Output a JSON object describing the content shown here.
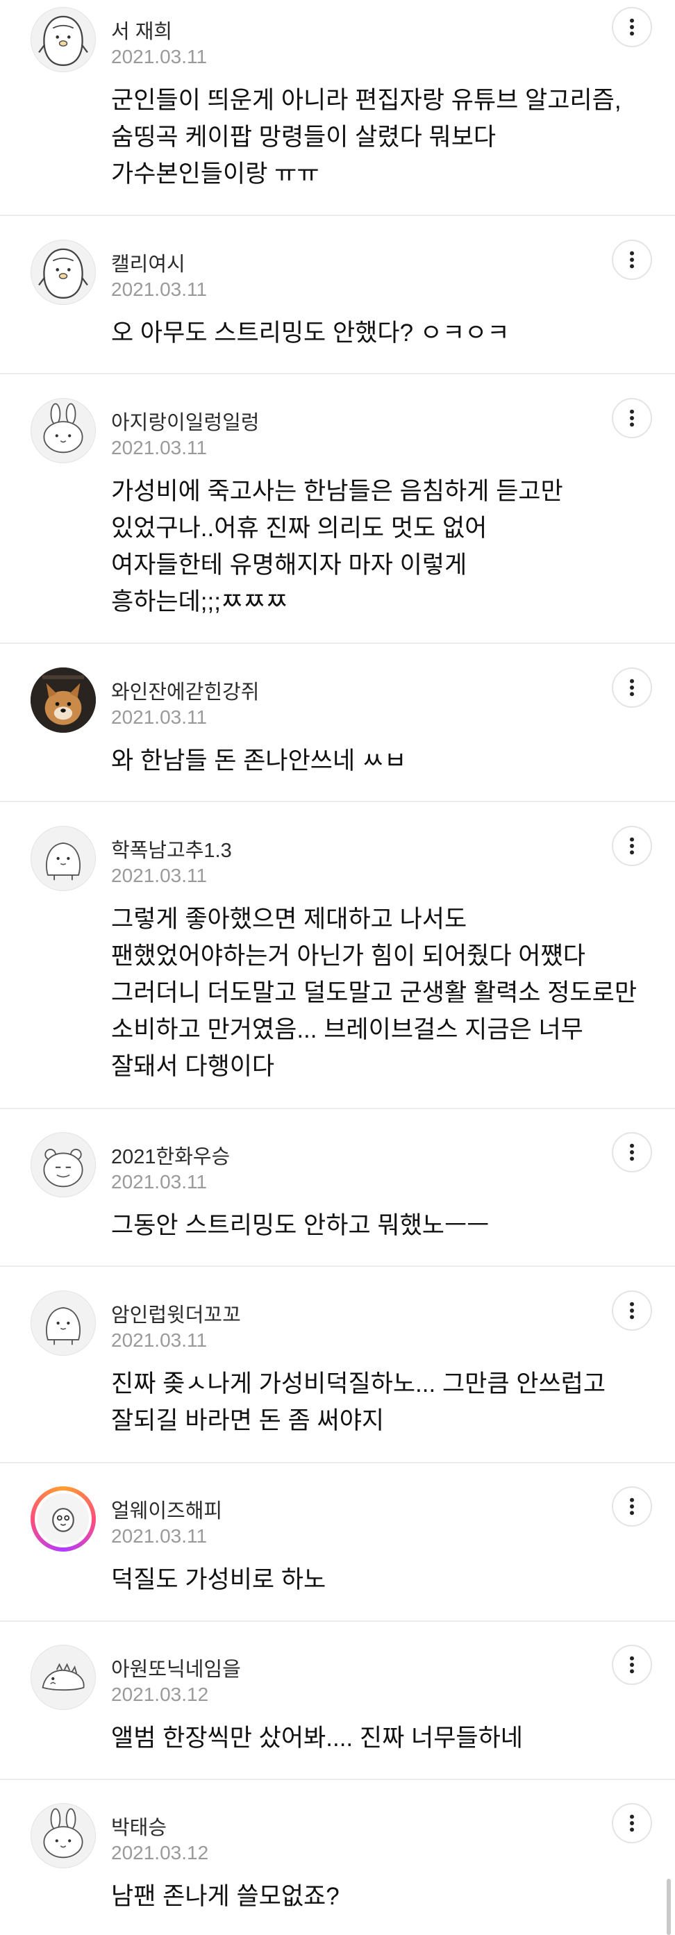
{
  "comments": [
    {
      "author": "서 재희",
      "date": "2021.03.11",
      "avatar": "penguin-icon",
      "lines": [
        "군인들이 띄운게 아니라 편집자랑 유튜브 알고리즘,",
        "숨띵곡 케이팝 망령들이 살렸다 뭐보다",
        "가수본인들이랑 ㅠㅠ"
      ]
    },
    {
      "author": "캘리여시",
      "date": "2021.03.11",
      "avatar": "penguin-icon",
      "lines": [
        "오 아무도 스트리밍도 안했다? ㅇㅋㅇㅋ"
      ]
    },
    {
      "author": "아지랑이일렁일렁",
      "date": "2021.03.11",
      "avatar": "rabbit-icon",
      "lines": [
        "가성비에 죽고사는 한남들은 음침하게 듣고만",
        "있었구나..어휴 진짜 의리도 멋도 없어",
        "여자들한테 유명해지자 마자 이렇게",
        "흥하는데;;;ㅉㅉㅉ"
      ]
    },
    {
      "author": "와인잔에갇힌강쥐",
      "date": "2021.03.11",
      "avatar": "dog-photo",
      "lines": [
        "와 한남들 돈 존나안쓰네 ㅆㅂ"
      ]
    },
    {
      "author": "학폭남고추1.3",
      "date": "2021.03.11",
      "avatar": "blob-icon",
      "lines": [
        "그렇게 좋아했으면 제대하고 나서도",
        "팬했었어야하는거 아닌가 힘이 되어줬다 어쩄다",
        "그러더니 더도말고 덜도말고 군생활 활력소 정도로만",
        "소비하고 만거였음... 브레이브걸스 지금은 너무",
        "잘돼서 다행이다"
      ]
    },
    {
      "author": "2021한화우승",
      "date": "2021.03.11",
      "avatar": "bear-icon",
      "lines": [
        "그동안 스트리밍도 안하고 뭐했노ㅡㅡ"
      ]
    },
    {
      "author": "암인럽윗더꼬꼬",
      "date": "2021.03.11",
      "avatar": "blob-icon",
      "lines": [
        "진짜 좆ㅅ나게 가성비덕질하노... 그만큼 안쓰럽고",
        "잘되길 바라면 돈 좀 써야지"
      ]
    },
    {
      "author": "얼웨이즈해피",
      "date": "2021.03.11",
      "avatar": "ring-character-icon",
      "lines": [
        "덕질도 가성비로 하노"
      ]
    },
    {
      "author": "아원또닉네임을",
      "date": "2021.03.12",
      "avatar": "dino-icon",
      "lines": [
        "앨범 한장씩만 샀어봐.... 진짜 너무들하네"
      ]
    },
    {
      "author": "박태승",
      "date": "2021.03.12",
      "avatar": "rabbit-icon",
      "lines": [
        "남팬 존나게 쓸모없죠?"
      ]
    }
  ],
  "more_icon": "more-vertical-icon",
  "colors": {
    "author": "#2b2b2b",
    "date": "#9a9a9a",
    "text": "#111111",
    "divider": "#ececec"
  }
}
